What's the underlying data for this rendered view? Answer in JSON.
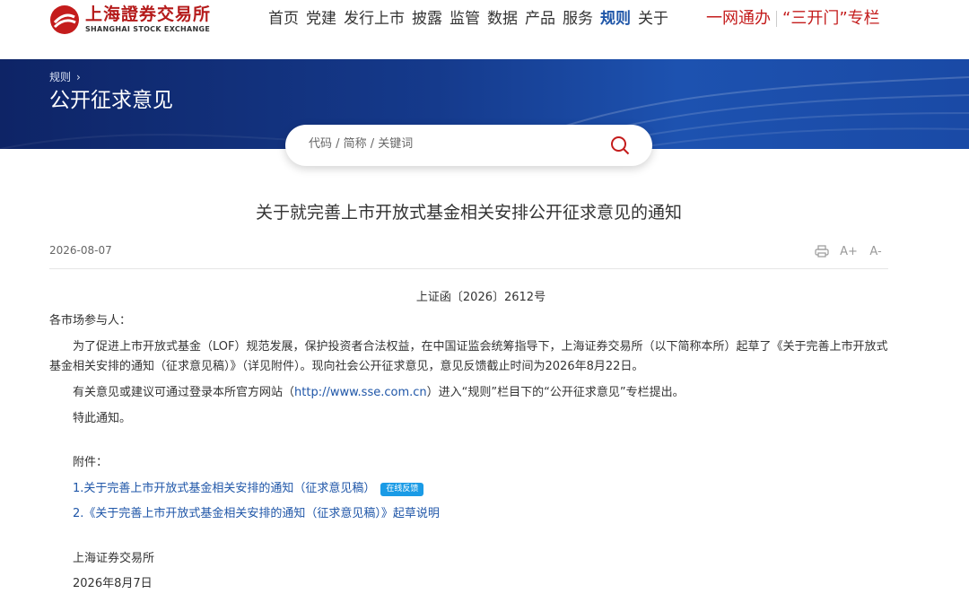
{
  "header": {
    "logo_cn": "上海證券交易所",
    "logo_en": "SHANGHAI STOCK EXCHANGE",
    "nav": [
      "首页",
      "党建",
      "发行上市",
      "披露",
      "监管",
      "数据",
      "产品",
      "服务",
      "规则",
      "关于"
    ],
    "active_nav": "规则",
    "special_links": [
      "一网通办",
      "“三开门”专栏"
    ]
  },
  "banner": {
    "breadcrumb": "规则",
    "title": "公开征求意见"
  },
  "search": {
    "placeholder": "代码 / 简称 / 关键词"
  },
  "article": {
    "title": "关于就完善上市开放式基金相关安排公开征求意见的通知",
    "date": "2026-08-07",
    "tools": {
      "print": "print-icon",
      "font_increase": "A+",
      "font_decrease": "A-"
    },
    "doc_number": "上证函〔2026〕2612号",
    "greeting": "各市场参与人：",
    "paragraph1": "为了促进上市开放式基金（LOF）规范发展，保护投资者合法权益，在中国证监会统筹指导下，上海证券交易所（以下简称本所）起草了《关于完善上市开放式基金相关安排的通知（征求意见稿）》（详见附件）。现向社会公开征求意见，意见反馈截止时间为2026年8月22日。",
    "paragraph2_before": "有关意见或建议可通过登录本所官方网站（",
    "paragraph2_url": "http://www.sse.com.cn",
    "paragraph2_after": "）进入“规则”栏目下的“公开征求意见”专栏提出。",
    "paragraph3": "特此通知。",
    "attachments_label": "附件：",
    "attachments": [
      {
        "text": "1.关于完善上市开放式基金相关安排的通知（征求意见稿）",
        "badge": "在线反馈"
      },
      {
        "text": "2.《关于完善上市开放式基金相关安排的通知（征求意见稿）》起草说明"
      }
    ],
    "signature": "上海证券交易所",
    "sign_date": "2026年8月7日"
  },
  "colors": {
    "brand_red": "#c41c1c",
    "link_blue": "#1f56a8",
    "banner_dark": "#0e2466",
    "badge_blue": "#1a9be6"
  }
}
